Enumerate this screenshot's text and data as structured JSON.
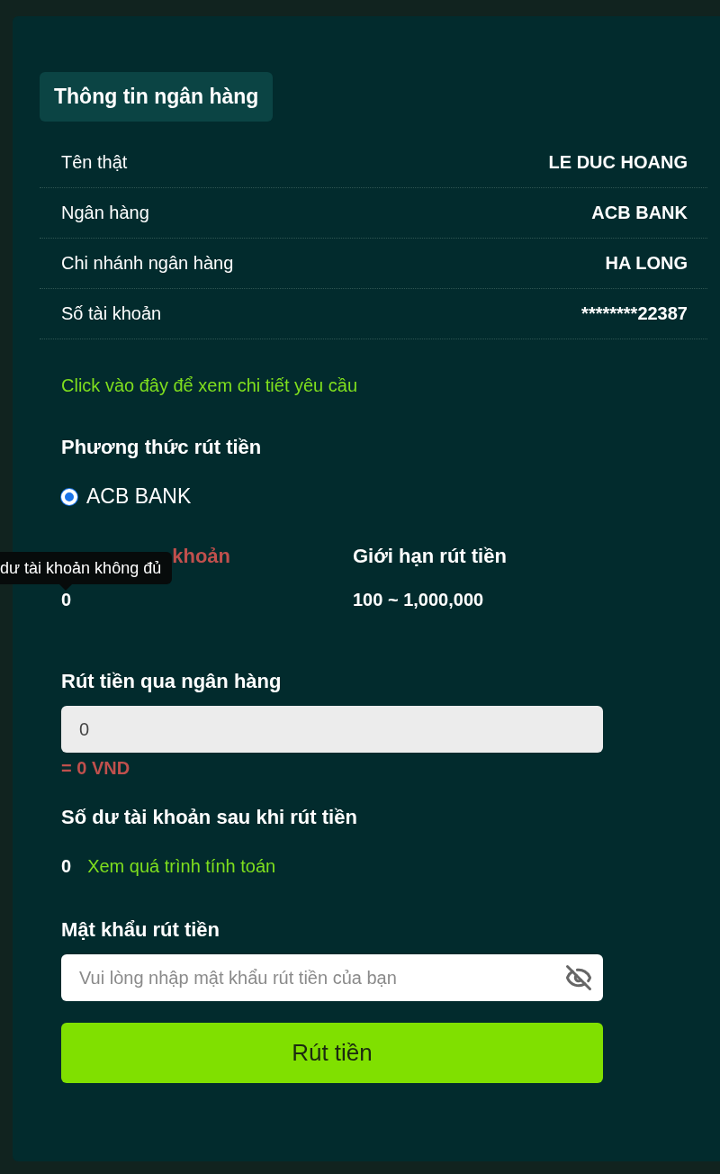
{
  "bank_info": {
    "title": "Thông tin ngân hàng",
    "rows": [
      {
        "label": "Tên thật",
        "value": "LE DUC HOANG"
      },
      {
        "label": "Ngân hàng",
        "value": "ACB BANK"
      },
      {
        "label": "Chi nhánh ngân hàng",
        "value": "HA LONG"
      },
      {
        "label": "Số tài khoản",
        "value": "********22387"
      }
    ]
  },
  "details_link": "Click vào đây để xem chi tiết yêu cầu",
  "method": {
    "title": "Phương thức rút tiền",
    "options": [
      {
        "label": "ACB BANK",
        "selected": true
      }
    ]
  },
  "balance": {
    "heading": "khoản",
    "value": "0",
    "tooltip": "dư tài khoản không đủ"
  },
  "limit": {
    "heading": "Giới hạn rút tiền",
    "value": "100 ~ 1,000,000"
  },
  "amount": {
    "title": "Rút tiền qua ngân hàng",
    "value": "0",
    "converted": "= 0 VND"
  },
  "after": {
    "title": "Số dư tài khoản sau khi rút tiền",
    "value": "0",
    "link": "Xem quá trình tính toán"
  },
  "password": {
    "title": "Mật khẩu rút tiền",
    "placeholder": "Vui lòng nhập mật khẩu rút tiền của bạn",
    "hidden": true
  },
  "submit": "Rút tiền"
}
